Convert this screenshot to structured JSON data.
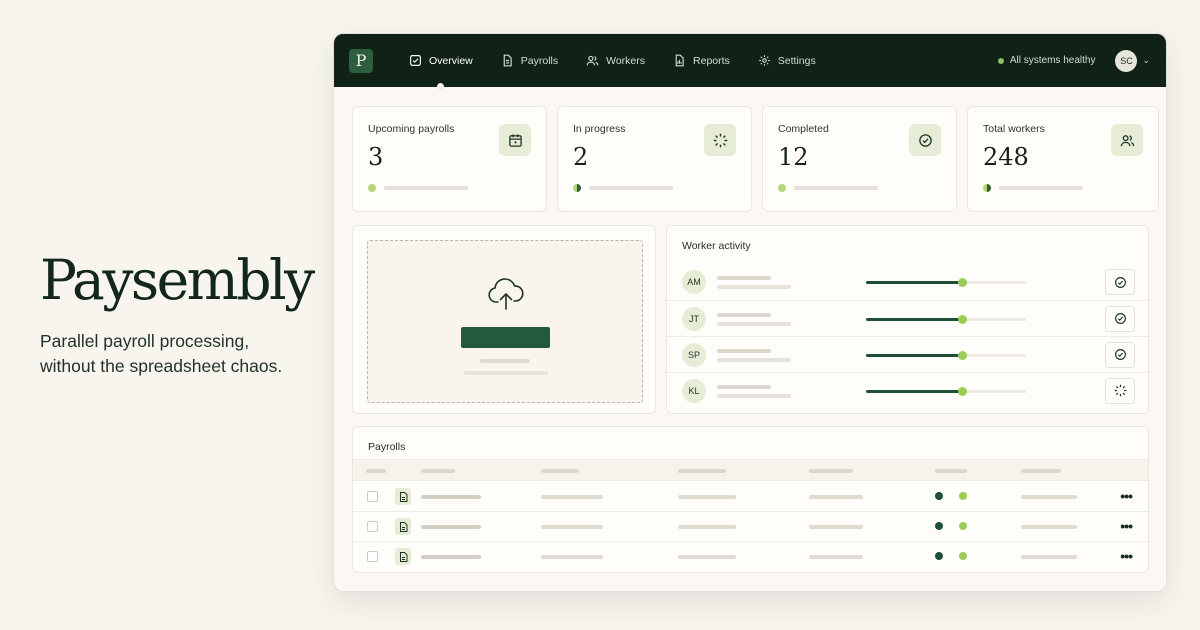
{
  "hero": {
    "brand": "Paysembly",
    "tagline_line1": "Parallel payroll processing,",
    "tagline_line2": "without the spreadsheet chaos."
  },
  "topbar": {
    "logo_letter": "P",
    "nav": [
      {
        "label": "Overview",
        "icon": "overview-icon",
        "active": true
      },
      {
        "label": "Payrolls",
        "icon": "document-icon",
        "active": false
      },
      {
        "label": "Workers",
        "icon": "users-icon",
        "active": false
      },
      {
        "label": "Reports",
        "icon": "report-icon",
        "active": false
      },
      {
        "label": "Settings",
        "icon": "gear-icon",
        "active": false
      }
    ],
    "status_text": "All systems healthy",
    "user_initials": "SC"
  },
  "stats": [
    {
      "label": "Upcoming payrolls",
      "value": "3",
      "icon": "calendar-icon"
    },
    {
      "label": "In progress",
      "value": "2",
      "icon": "spinner-icon"
    },
    {
      "label": "Completed",
      "value": "12",
      "icon": "check-circle-icon"
    },
    {
      "label": "Total workers",
      "value": "248",
      "icon": "users-icon"
    }
  ],
  "activity": {
    "title": "Worker activity",
    "workers": [
      {
        "initials": "AM",
        "progress": 0.6,
        "status": "check-circle-icon"
      },
      {
        "initials": "JT",
        "progress": 0.6,
        "status": "check-circle-icon"
      },
      {
        "initials": "SP",
        "progress": 0.6,
        "status": "check-circle-icon"
      },
      {
        "initials": "KL",
        "progress": 0.6,
        "status": "spinner-icon"
      }
    ]
  },
  "payrolls": {
    "title": "Payrolls",
    "more_label": "•••"
  },
  "colors": {
    "topbar": "#102116",
    "accent": "#245a3b",
    "lime": "#9ccc58",
    "background": "#f8f5ef"
  }
}
